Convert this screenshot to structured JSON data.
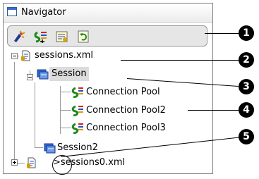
{
  "window": {
    "title": "Navigator",
    "icon": "window-icon"
  },
  "toolbar": {
    "buttons": [
      {
        "name": "toolbar-button-1",
        "icon": "wizard-icon"
      },
      {
        "name": "toolbar-button-2",
        "icon": "connection-icon"
      },
      {
        "name": "toolbar-button-3",
        "icon": "properties-icon"
      },
      {
        "name": "toolbar-button-4",
        "icon": "refresh-icon"
      }
    ]
  },
  "tree": {
    "sessions_xml": "sessions.xml",
    "session": "Session",
    "connection_pool": "Connection Pool",
    "connection_pool2": "Connection Pool2",
    "connection_pool3": "Connection Pool3",
    "session2": "Session2",
    "sessions0_xml": ">sessions0.xml"
  },
  "callouts": [
    "1",
    "2",
    "3",
    "4",
    "5"
  ]
}
